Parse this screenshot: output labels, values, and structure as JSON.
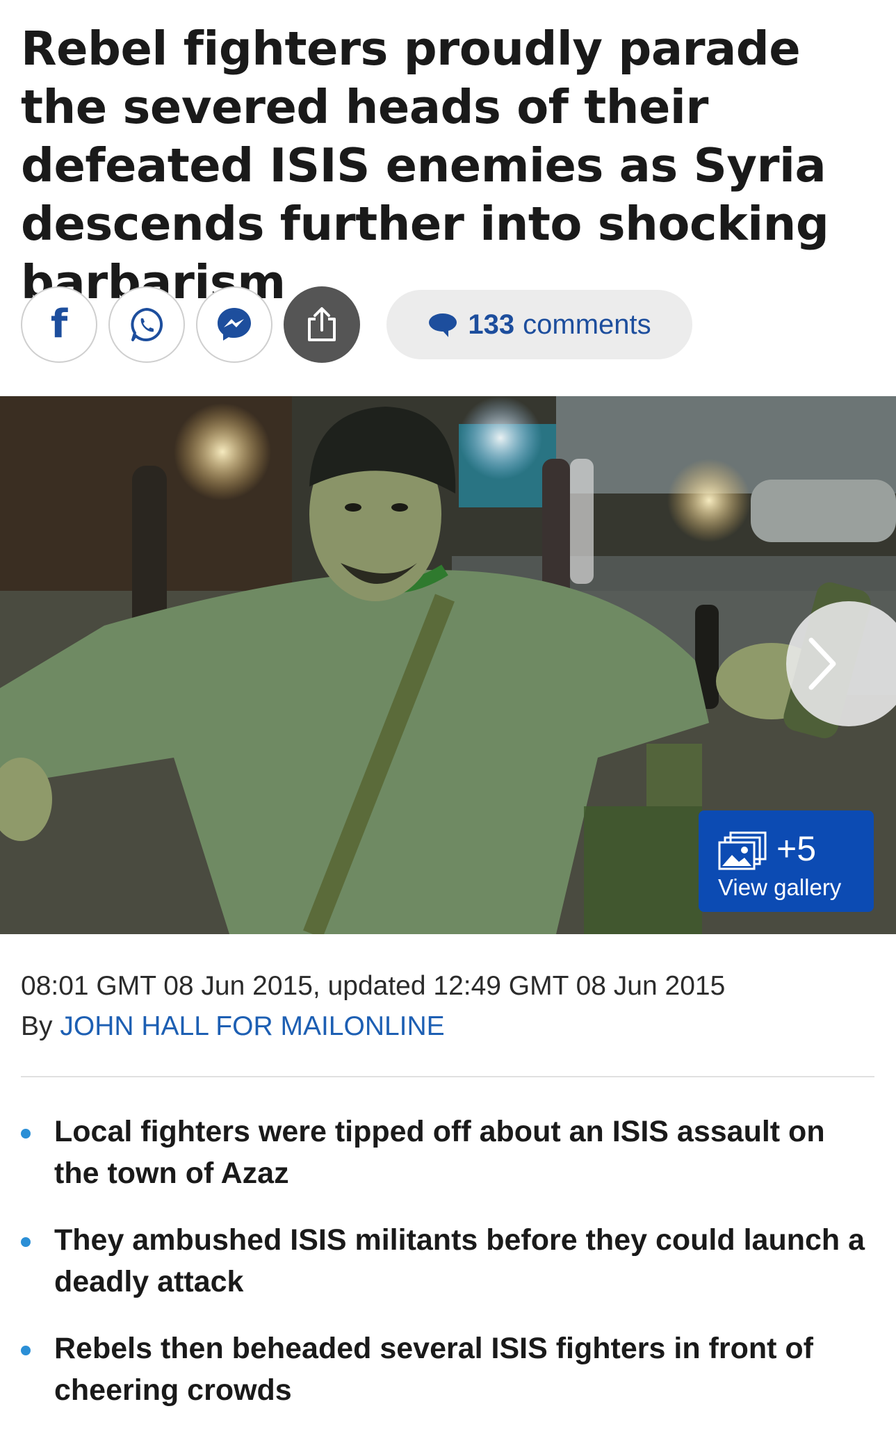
{
  "article": {
    "headline": "Rebel fighters proudly parade the severed heads of their defeated ISIS enemies as Syria descends further into shocking barbarism",
    "timestamp": "08:01 GMT 08 Jun 2015, updated 12:49 GMT 08 Jun 2015",
    "byline_prefix": "By",
    "byline_author": "JOHN HALL FOR MAILONLINE"
  },
  "share": {
    "buttons": [
      {
        "icon": "facebook-icon"
      },
      {
        "icon": "whatsapp-icon"
      },
      {
        "icon": "messenger-icon"
      },
      {
        "icon": "share-icon"
      }
    ],
    "comments_count": "133",
    "comments_label": "comments"
  },
  "gallery": {
    "extra_count": "+5",
    "label": "View gallery",
    "next_icon": "chevron-right-icon"
  },
  "bullets": [
    "Local fighters were tipped off about an ISIS assault on the town of Azaz",
    "They ambushed ISIS militants before they could launch a deadly attack",
    "Rebels then beheaded several ISIS fighters in front of cheering crowds"
  ],
  "colors": {
    "accent_blue": "#1d4e9d",
    "gallery_blue": "#0c4bb3",
    "bullet_blue": "#2b8fd6",
    "byline_blue": "#1d5fb3"
  }
}
